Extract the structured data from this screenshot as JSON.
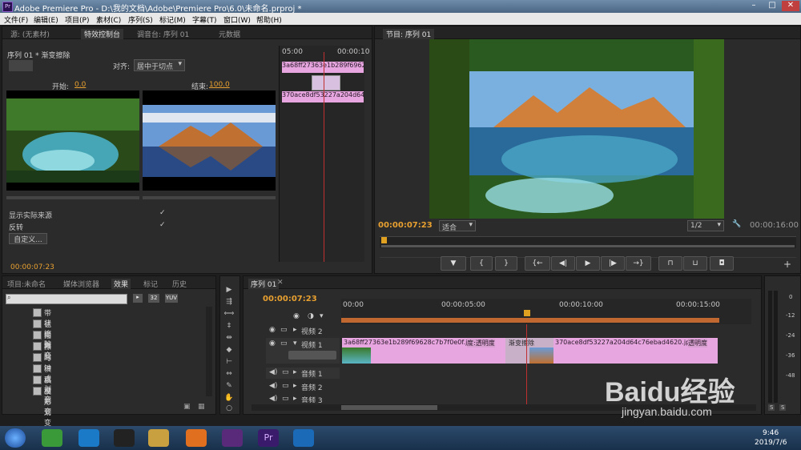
{
  "window": {
    "title": "Adobe Premiere Pro - D:\\我的文档\\Adobe\\Premiere Pro\\6.0\\未命名.prproj *",
    "logo": "Pr"
  },
  "menu": [
    "文件(F)",
    "编辑(E)",
    "项目(P)",
    "素材(C)",
    "序列(S)",
    "标记(M)",
    "字幕(T)",
    "窗口(W)",
    "帮助(H)"
  ],
  "left_tabs": [
    "源: (无素材)",
    "特效控制台",
    "调音台: 序列 01",
    "元数据"
  ],
  "effect_controls": {
    "header": "序列 01 * 渐变擦除",
    "align_label": "对齐:",
    "align_value": "居中于切点",
    "start_label": "开始:",
    "start_value": "0.0",
    "end_label": "结束:",
    "end_value": "100.0",
    "show_source": "显示实际来源",
    "reverse": "反转",
    "custom_button": "自定义...",
    "timecode": "00:00:07:23",
    "mini_tl_start": "05:00",
    "mini_tl_end": "00:00:10",
    "clip_a": "3a68ff27363e1b289f69628c7b7f0e0f.jpg",
    "clip_b": "370ace8df53227a204d64c76ebad4620.jpg"
  },
  "program": {
    "tab": "节目: 序列 01",
    "timecode": "00:00:07:23",
    "fit": "适合",
    "zoom": "1/2",
    "duration": "00:00:16:00"
  },
  "project_tabs": [
    "项目:未命名",
    "媒体浏览器",
    "效果",
    "标记",
    "历史"
  ],
  "project_buttons": [
    "32",
    "YUV"
  ],
  "effects_list": [
    "带状擦除",
    "径向划变",
    "插入",
    "擦除",
    "时钟式划变",
    "棋盘",
    "棋盘划变",
    "楔形划变"
  ],
  "timeline": {
    "tab": "序列 01",
    "timecode": "00:00:07:23",
    "ruler": [
      "00:00",
      "00:00:05:00",
      "00:00:10:00",
      "00:00:15:00"
    ],
    "tracks": {
      "v2": "视频 2",
      "v1": "视频 1",
      "a1": "音频 1",
      "a2": "音频 2",
      "a3": "音频 3"
    },
    "clip1_label": "3a68ff27363e1b289f69628c7b7f0e0f.jpg",
    "clip1_opacity": "度:透明度",
    "transition": "渐变擦除",
    "clip2_label": "370ace8df53227a204d64c76ebad4620.jpg",
    "clip2_opacity": "透明度"
  },
  "meter_labels": [
    "0",
    "-12",
    "-24",
    "-36",
    "-48"
  ],
  "meter_buttons": [
    "S",
    "S"
  ],
  "taskbar": {
    "time": "9:46",
    "date": "2019/7/6"
  },
  "watermark": {
    "text": "Baidu经验",
    "url": "jingyan.baidu.com"
  }
}
